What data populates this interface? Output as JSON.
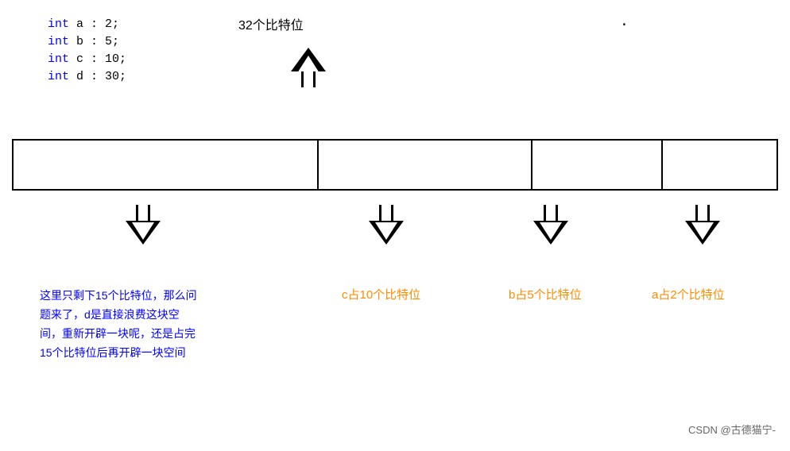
{
  "code": {
    "lines": [
      {
        "keyword": "int",
        "rest": " a : 2;"
      },
      {
        "keyword": "int",
        "rest": " b : 5;"
      },
      {
        "keyword": "int",
        "rest": " c : 10;"
      },
      {
        "keyword": "int",
        "rest": " d : 30;"
      }
    ]
  },
  "labels": {
    "bits32": "32个比特位",
    "desc": "这里只剩下15个比特位，那么问题来了，d是直接浪费这块空间，重新开辟一块呢，还是占完15个比特位后再开辟一块空间",
    "label_c": "c占10个比特位",
    "label_b": "b占5个比特位",
    "label_a": "a占2个比特位",
    "watermark": "CSDN @古德猫宁-"
  },
  "memory": {
    "segments": [
      {
        "width_pct": 40
      },
      {
        "width_pct": 28
      },
      {
        "width_pct": 17
      },
      {
        "width_pct": 15
      }
    ]
  }
}
